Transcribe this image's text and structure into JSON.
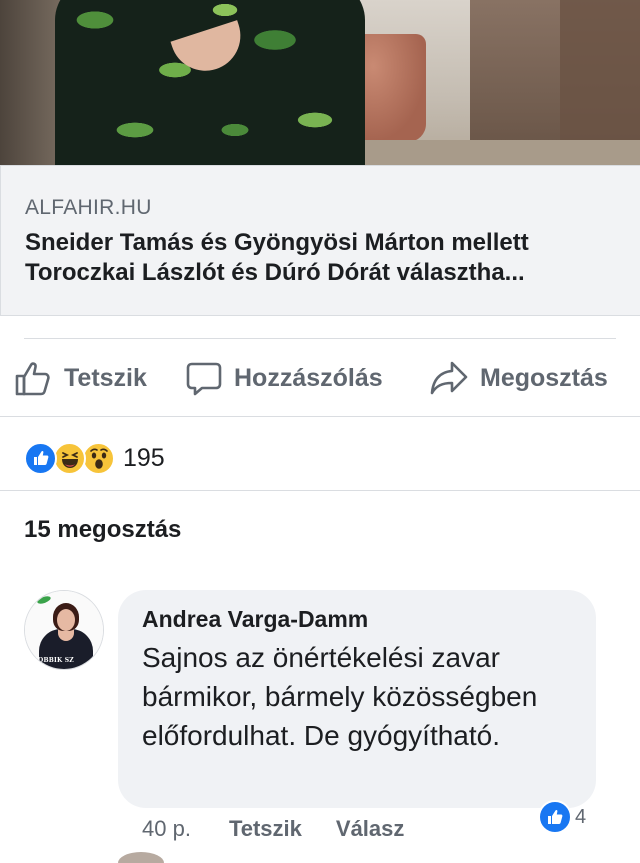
{
  "link_preview": {
    "domain": "ALFAHIR.HU",
    "title": "Sneider Tamás és Gyöngyösi Márton mellett Toroczkai Lászlót és Dúró Dórát választha..."
  },
  "actions": {
    "like_label": "Tetszik",
    "comment_label": "Hozzászólás",
    "share_label": "Megosztás"
  },
  "reactions": {
    "types": [
      "like",
      "haha",
      "wow"
    ],
    "count": "195"
  },
  "shares": {
    "label": "15 megosztás"
  },
  "comment": {
    "author": "Andrea Varga-Damm",
    "avatar_tag": "JOBBIK SZ",
    "text": "Sajnos az önértékelési zavar bármikor, bármely közösségben előfordulhat. De gyógyítható.",
    "time": "40 p.",
    "like_label": "Tetszik",
    "reply_label": "Válasz",
    "reaction_count": "4"
  },
  "colors": {
    "facebook_blue": "#1877f2",
    "text_primary": "#1c1e21",
    "text_secondary": "#606770",
    "bubble_bg": "#f0f2f5",
    "preview_bg": "#f2f3f5",
    "divider": "#dadde1"
  }
}
